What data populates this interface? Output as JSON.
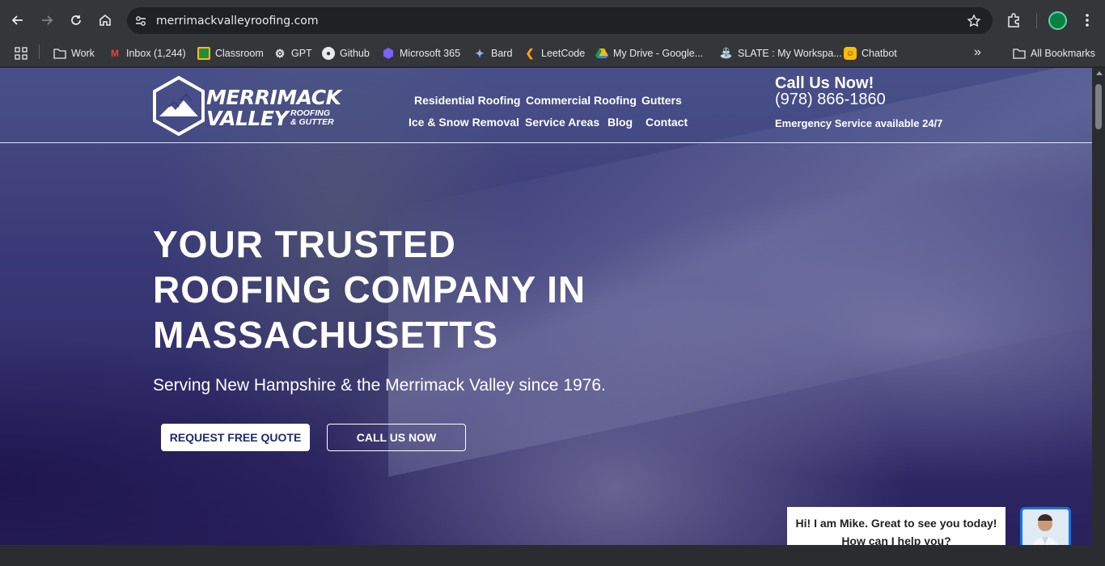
{
  "browser": {
    "url": "merrimackvalleyroofing.com",
    "bookmarks": [
      {
        "label": "Work",
        "icon": "folder-icon"
      },
      {
        "label": "Inbox (1,244)",
        "icon": "gmail-icon"
      },
      {
        "label": "Classroom",
        "icon": "classroom-icon"
      },
      {
        "label": "GPT",
        "icon": "gpt-icon"
      },
      {
        "label": "Github",
        "icon": "github-icon"
      },
      {
        "label": "Microsoft 365",
        "icon": "microsoft365-icon"
      },
      {
        "label": "Bard",
        "icon": "bard-icon"
      },
      {
        "label": "LeetCode",
        "icon": "leetcode-icon"
      },
      {
        "label": "My Drive - Google...",
        "icon": "drive-icon"
      },
      {
        "label": "SLATE : My Workspa...",
        "icon": "slate-icon"
      },
      {
        "label": "Chatbot",
        "icon": "chatbot-icon"
      }
    ],
    "all_bookmarks": "All Bookmarks"
  },
  "site": {
    "logo": {
      "line1": "MERRIMACK",
      "line2": "VALLEY",
      "sub1": "ROOFING",
      "sub2": "& GUTTER"
    },
    "nav": {
      "residential": "Residential Roofing",
      "commercial": "Commercial Roofing",
      "gutters": "Gutters",
      "ice_snow": "Ice & Snow Removal",
      "service_areas": "Service Areas",
      "blog": "Blog",
      "contact": "Contact"
    },
    "call": {
      "title": "Call Us Now!",
      "phone": "(978) 866-1860",
      "note": "Emergency Service available 24/7"
    },
    "hero": {
      "title_line1": "YOUR TRUSTED",
      "title_line2": "ROOFING COMPANY IN",
      "title_line3": "MASSACHUSETTS",
      "subtitle": "Serving New Hampshire & the Merrimack Valley since 1976.",
      "btn_quote": "REQUEST FREE QUOTE",
      "btn_call": "CALL US NOW"
    },
    "chat": {
      "line1": "Hi! I am Mike. Great to see you today!",
      "line2": "How can I help you?"
    }
  }
}
